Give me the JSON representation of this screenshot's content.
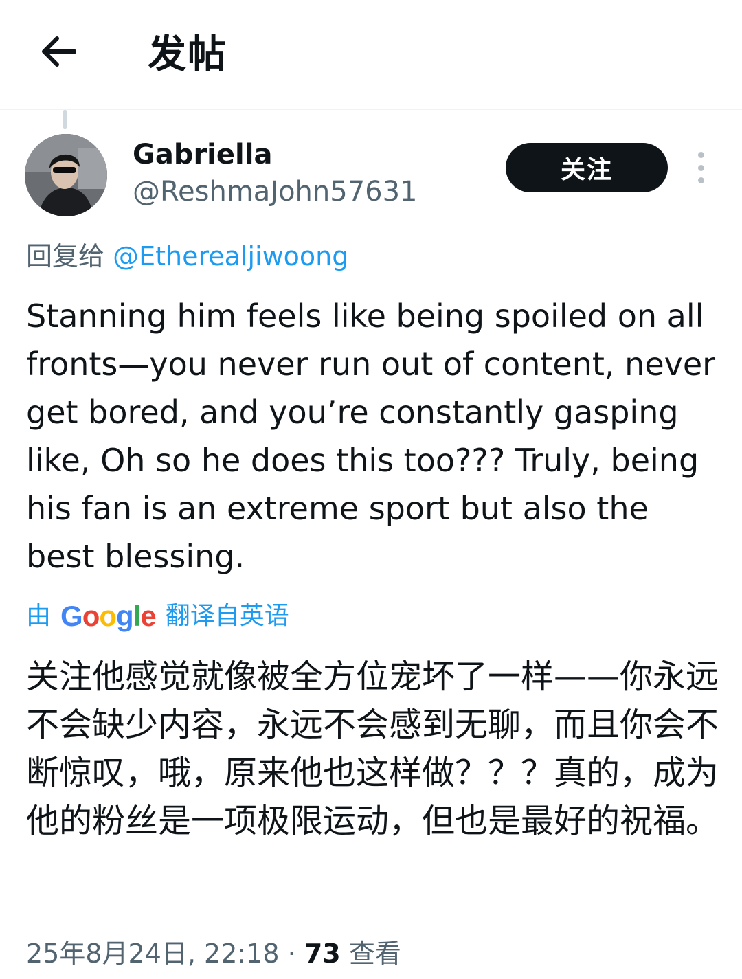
{
  "header": {
    "title": "发帖",
    "back_icon": "arrow-left-icon"
  },
  "tweet": {
    "display_name": "Gabriella",
    "handle": "@ReshmaJohn57631",
    "follow_label": "关注",
    "more_icon": "more-vertical-icon",
    "reply_prefix": "回复给",
    "reply_mention": "@Etherealjiwoong",
    "text": "Stanning him feels like being spoiled on all fronts—you never run out of content, never get bored, and you’re constantly gasping like, Oh so he does this too??? Truly, being his fan is an extreme sport but also the best blessing.",
    "translated_prefix": "由",
    "translated_brand": "Google",
    "translated_suffix": "翻译自英语",
    "translation": "关注他感觉就像被全方位宠坏了一样——你永远不会缺少内容，永远不会感到无聊，而且你会不断惊叹，哦，原来他也这样做？？？真的，成为他的粉丝是一项极限运动，但也是最好的祝福。",
    "timestamp": "25年8月24日, 22:18",
    "separator": "·",
    "views_count": "73",
    "views_label": "查看"
  },
  "colors": {
    "text": "#0f1419",
    "secondary": "#536471",
    "link": "#1d9bf0",
    "follow_bg": "#0f1419"
  }
}
